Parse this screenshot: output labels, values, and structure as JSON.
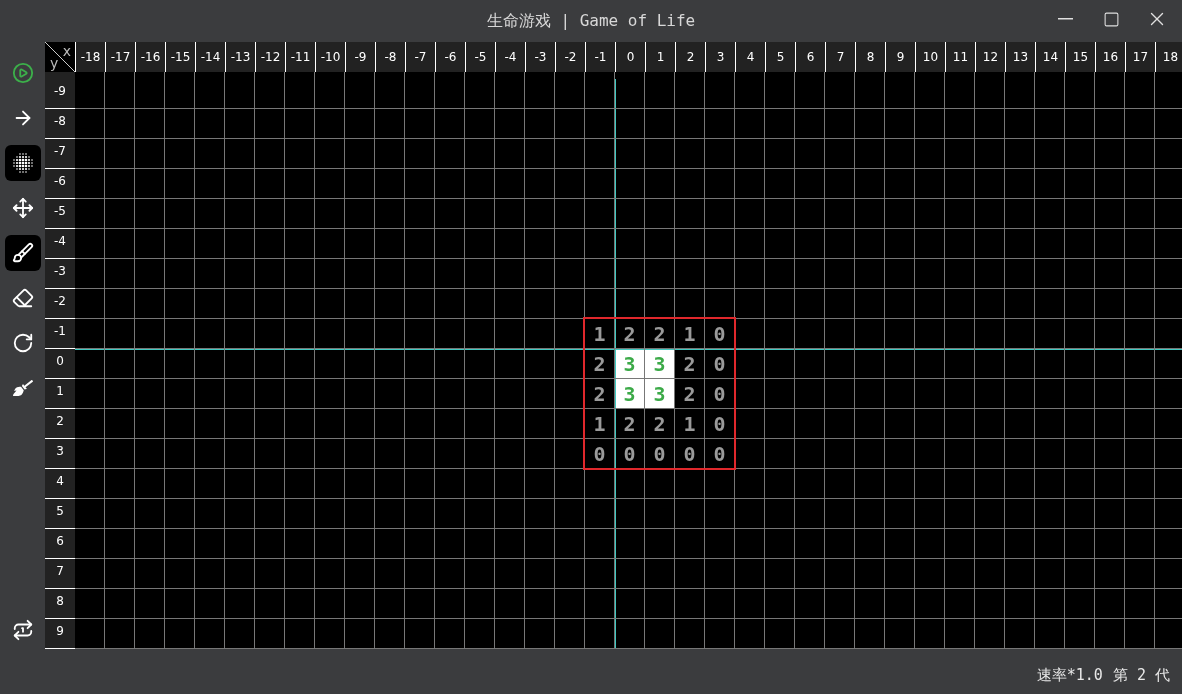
{
  "window": {
    "title": "生命游戏 | Game of Life"
  },
  "tools": [
    {
      "kind": "play",
      "selected": false
    },
    {
      "kind": "step",
      "selected": false
    },
    {
      "kind": "grid",
      "selected": true
    },
    {
      "kind": "move",
      "selected": false
    },
    {
      "kind": "brush",
      "selected": true
    },
    {
      "kind": "eraser",
      "selected": false
    },
    {
      "kind": "reset",
      "selected": false
    },
    {
      "kind": "clear",
      "selected": false
    },
    {
      "kind": "repeat",
      "selected": false
    }
  ],
  "board": {
    "corner": {
      "x_label": "x",
      "y_label": "y"
    },
    "columns": [
      {
        "label": "-18"
      },
      {
        "label": "-17"
      },
      {
        "label": "-16"
      },
      {
        "label": "-15"
      },
      {
        "label": "-14"
      },
      {
        "label": "-13"
      },
      {
        "label": "-12"
      },
      {
        "label": "-11"
      },
      {
        "label": "-10"
      },
      {
        "label": "-9"
      },
      {
        "label": "-8"
      },
      {
        "label": "-7"
      },
      {
        "label": "-6"
      },
      {
        "label": "-5"
      },
      {
        "label": "-4"
      },
      {
        "label": "-3"
      },
      {
        "label": "-2"
      },
      {
        "label": "-1",
        "in_selection": true
      },
      {
        "label": "0",
        "axis": true,
        "in_selection": true
      },
      {
        "label": "1",
        "in_selection": true
      },
      {
        "label": "2",
        "in_selection": true
      },
      {
        "label": "3",
        "in_selection": true
      },
      {
        "label": "4"
      },
      {
        "label": "5"
      },
      {
        "label": "6"
      },
      {
        "label": "7"
      },
      {
        "label": "8"
      },
      {
        "label": "9"
      },
      {
        "label": "10"
      },
      {
        "label": "11"
      },
      {
        "label": "12"
      },
      {
        "label": "13"
      },
      {
        "label": "14"
      },
      {
        "label": "15"
      },
      {
        "label": "16"
      },
      {
        "label": "17"
      },
      {
        "label": "18"
      }
    ],
    "rows": [
      {
        "label": "-9"
      },
      {
        "label": "-8"
      },
      {
        "label": "-7"
      },
      {
        "label": "-6"
      },
      {
        "label": "-5"
      },
      {
        "label": "-4"
      },
      {
        "label": "-3"
      },
      {
        "label": "-2"
      },
      {
        "label": "-1",
        "in_selection": true,
        "counts": [
          {
            "text": "1",
            "alive": false
          },
          {
            "text": "2",
            "alive": false
          },
          {
            "text": "2",
            "alive": false
          },
          {
            "text": "1",
            "alive": false
          },
          {
            "text": "0",
            "alive": false
          }
        ]
      },
      {
        "label": "0",
        "axis": true,
        "in_selection": true,
        "counts": [
          {
            "text": "2",
            "alive": false
          },
          {
            "text": "3",
            "alive": true
          },
          {
            "text": "3",
            "alive": true
          },
          {
            "text": "2",
            "alive": false
          },
          {
            "text": "0",
            "alive": false
          }
        ]
      },
      {
        "label": "1",
        "in_selection": true,
        "counts": [
          {
            "text": "2",
            "alive": false
          },
          {
            "text": "3",
            "alive": true
          },
          {
            "text": "3",
            "alive": true
          },
          {
            "text": "2",
            "alive": false
          },
          {
            "text": "0",
            "alive": false
          }
        ]
      },
      {
        "label": "2",
        "in_selection": true,
        "counts": [
          {
            "text": "1",
            "alive": false
          },
          {
            "text": "2",
            "alive": false
          },
          {
            "text": "2",
            "alive": false
          },
          {
            "text": "1",
            "alive": false
          },
          {
            "text": "0",
            "alive": false
          }
        ]
      },
      {
        "label": "3",
        "in_selection": true,
        "counts": [
          {
            "text": "0",
            "alive": false
          },
          {
            "text": "0",
            "alive": false
          },
          {
            "text": "0",
            "alive": false
          },
          {
            "text": "0",
            "alive": false
          },
          {
            "text": "0",
            "alive": false
          }
        ]
      },
      {
        "label": "4"
      },
      {
        "label": "5"
      },
      {
        "label": "6"
      },
      {
        "label": "7"
      },
      {
        "label": "8"
      },
      {
        "label": "9"
      }
    ]
  },
  "status_bar": {
    "speed": "速率*1.0",
    "generation": "第 2 代"
  }
}
